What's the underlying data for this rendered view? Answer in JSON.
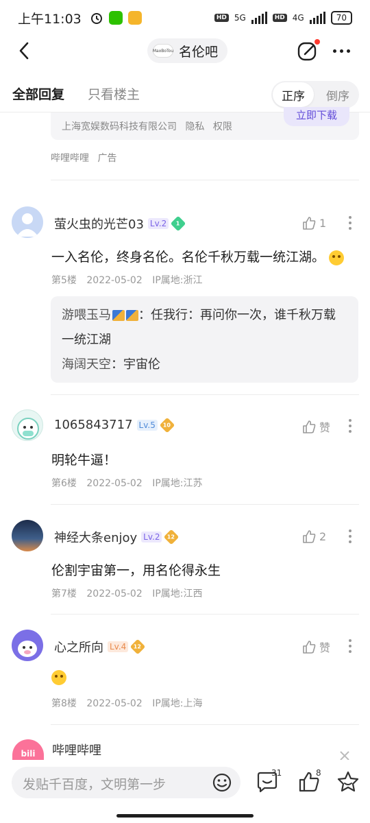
{
  "status_bar": {
    "time": "上午11:03",
    "network1": "5G",
    "network2": "4G",
    "battery": "70"
  },
  "nav": {
    "forum_name": "名伦吧",
    "forum_logo_text": "MaxBoTou"
  },
  "tabs": {
    "all": "全部回复",
    "owner_only": "只看楼主",
    "order_asc": "正序",
    "order_desc": "倒序"
  },
  "ad_top": {
    "company": "上海宽娱数码科技有限公司",
    "privacy": "隐私",
    "permission": "权限",
    "download": "立即下载",
    "advertiser": "哔哩哔哩",
    "ad_label": "广告"
  },
  "posts": [
    {
      "username": "萤火虫的光芒03",
      "level": "Lv.2",
      "badge": "1",
      "likes": "1",
      "content": "一入名伦，终身名伦。名伦千秋万载一统江湖。",
      "floor": "第5楼",
      "date": "2022-05-02",
      "ip": "IP属地:浙江",
      "replies": [
        {
          "name": "游喂玉马",
          "text": "：任我行：再问你一次，谁千秋万载一统江湖"
        },
        {
          "name": "海阔天空",
          "text": "：宇宙伦"
        }
      ]
    },
    {
      "username": "1065843717",
      "level": "Lv.5",
      "badge": "10",
      "likes": "赞",
      "content": "明轮牛逼！",
      "floor": "第6楼",
      "date": "2022-05-02",
      "ip": "IP属地:江苏"
    },
    {
      "username": "神经大条enjoy",
      "level": "Lv.2",
      "badge": "12",
      "likes": "2",
      "content": "伦割宇宙第一，用名伦得永生",
      "floor": "第7楼",
      "date": "2022-05-02",
      "ip": "IP属地:江西"
    },
    {
      "username": "心之所向",
      "level": "Lv.4",
      "badge": "12",
      "likes": "赞",
      "content": "",
      "floor": "第8楼",
      "date": "2022-05-02",
      "ip": "IP属地:上海"
    }
  ],
  "ad_bottom": {
    "name": "哔哩哔哩",
    "avatar_text": "bili"
  },
  "bottom_bar": {
    "placeholder": "发贴千百度，文明第一步",
    "comment_count": "31",
    "like_count": "8"
  },
  "colors": {
    "accent_purple": "#7a63e6",
    "badge_gold": "#f0b13a",
    "badge_green": "#3fcf8e",
    "bili_pink": "#fb7299"
  }
}
